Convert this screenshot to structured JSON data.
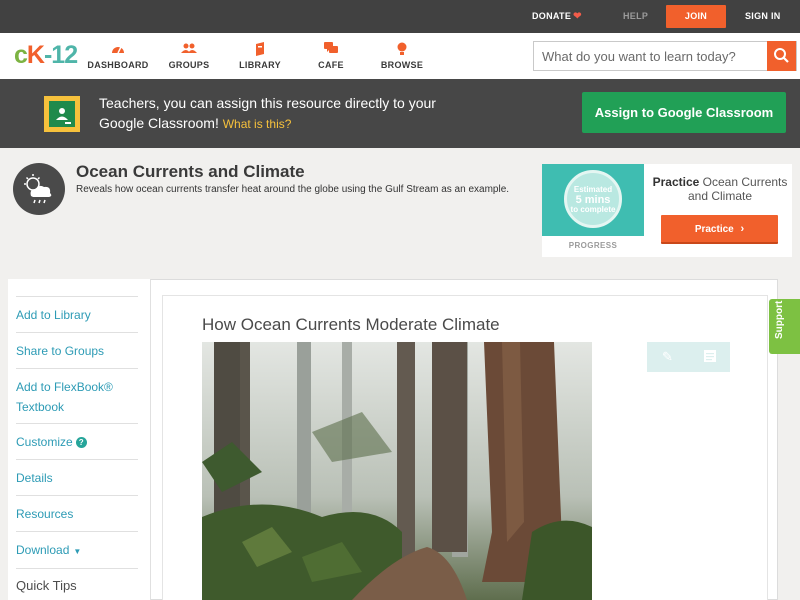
{
  "topbar": {
    "donate": "DONATE",
    "help": "HELP",
    "join": "JOIN",
    "signin": "SIGN IN"
  },
  "logo": "ck-12",
  "nav": [
    {
      "label": "DASHBOARD",
      "icon": "dashboard-icon"
    },
    {
      "label": "GROUPS",
      "icon": "groups-icon"
    },
    {
      "label": "LIBRARY",
      "icon": "library-icon"
    },
    {
      "label": "CAFE",
      "icon": "cafe-icon"
    },
    {
      "label": "BROWSE",
      "icon": "browse-icon"
    }
  ],
  "search": {
    "placeholder": "What do you want to learn today?"
  },
  "classroom": {
    "line": "Teachers, you can assign this resource directly to your Google Classroom!",
    "what": "What is this?",
    "button": "Assign to Google Classroom"
  },
  "concept": {
    "title": "Ocean Currents and Climate",
    "description": "Reveals how ocean currents transfer heat around the globe using the Gulf Stream as an example."
  },
  "practice": {
    "estimated": "Estimated",
    "mins": "5 mins",
    "complete": "to complete",
    "progress_label": "PROGRESS",
    "title_bold": "Practice",
    "title_rest": "Ocean Currents and Climate",
    "button": "Practice"
  },
  "sidebar": {
    "items": [
      {
        "label": "Add to Library"
      },
      {
        "label": "Share to Groups"
      },
      {
        "label": "Add to FlexBook® Textbook"
      },
      {
        "label": "Customize"
      },
      {
        "label": "Details"
      },
      {
        "label": "Resources"
      },
      {
        "label": "Download"
      }
    ],
    "quick_tips": "Quick Tips"
  },
  "document": {
    "title": "How Ocean Currents Moderate Climate"
  },
  "support": "Support",
  "colors": {
    "accent": "#f1602c",
    "green_button": "#21a056",
    "link": "#2d9bb5",
    "support": "#7dc142"
  }
}
